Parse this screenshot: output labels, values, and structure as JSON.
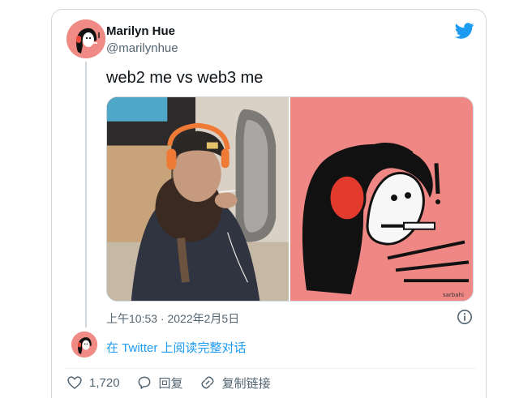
{
  "author": {
    "name": "Marilyn Hue",
    "handle": "@marilynhue"
  },
  "tweet": {
    "text": "web2 me vs web3 me",
    "timestamp": "上午10:53 · 2022年2月5日"
  },
  "media": {
    "left_image": "photo-of-woman-with-headphones",
    "right_image": "drawing-of-character-with-headphones"
  },
  "links": {
    "read_conversation": "在 Twitter 上阅读完整对话"
  },
  "actions": {
    "likes": "1,720",
    "reply": "回复",
    "copy_link": "复制链接"
  },
  "icons": [
    "twitter-bird-icon",
    "info-icon",
    "heart-icon",
    "reply-icon",
    "link-icon"
  ],
  "colors": {
    "accent": "#1d9bf0",
    "muted": "#536471",
    "avatar_bg": "#f08a84"
  }
}
